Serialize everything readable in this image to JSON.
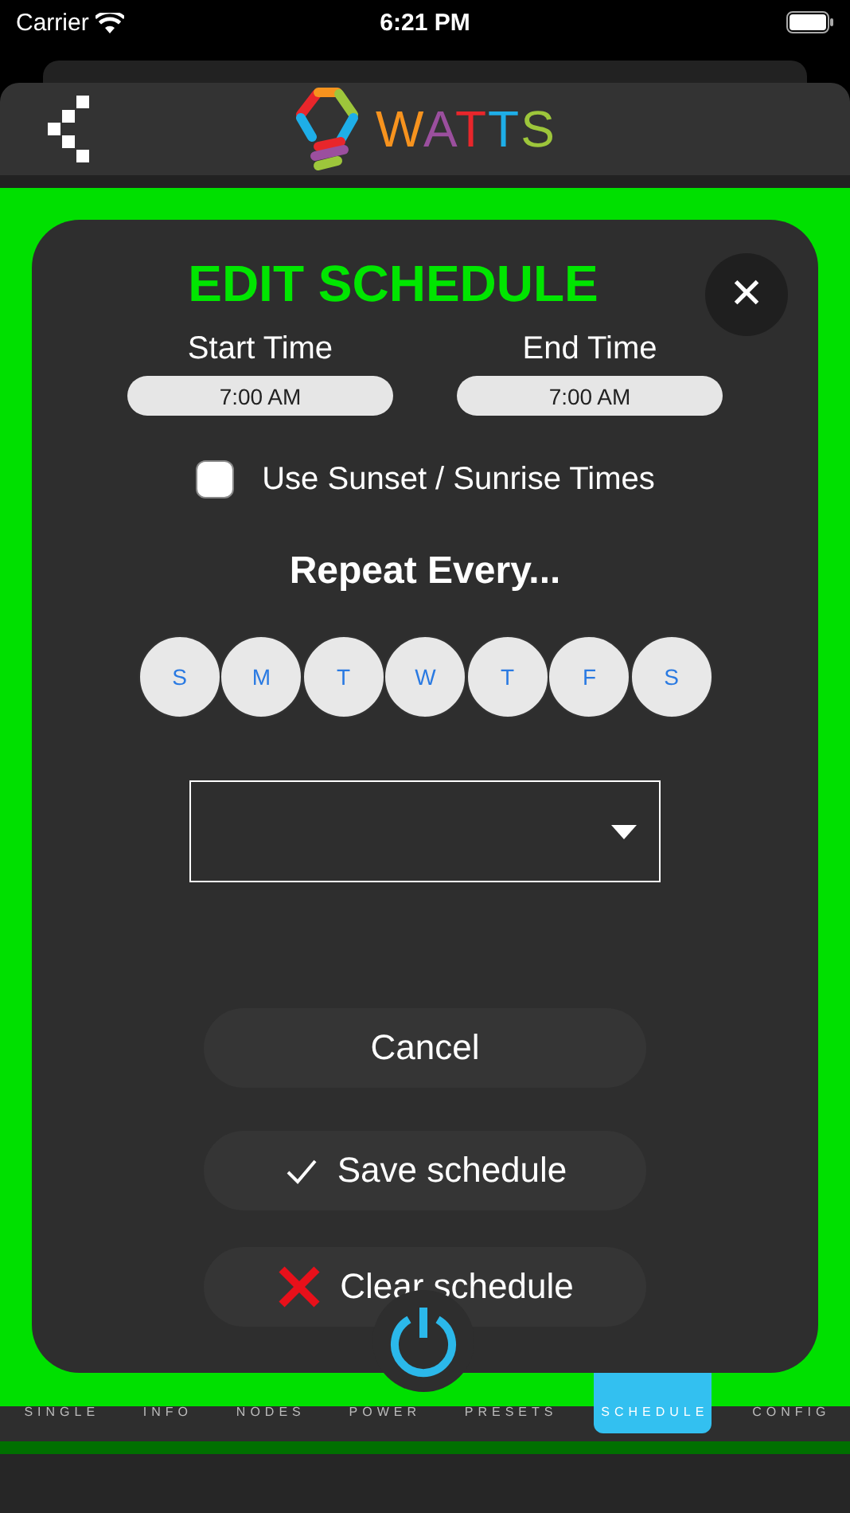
{
  "status_bar": {
    "carrier": "Carrier",
    "time": "6:21 PM"
  },
  "header": {
    "logo_text": "WATTS"
  },
  "dialog": {
    "title": "EDIT SCHEDULE",
    "close": "✕",
    "start": {
      "label": "Start Time",
      "value": "7:00 AM"
    },
    "end": {
      "label": "End Time",
      "value": "7:00 AM"
    },
    "sunset": {
      "label": "Use Sunset / Sunrise Times",
      "checked": false
    },
    "repeat_heading": "Repeat Every...",
    "days": [
      {
        "label": "S",
        "selected": false
      },
      {
        "label": "M",
        "selected": false
      },
      {
        "label": "T",
        "selected": false
      },
      {
        "label": "W",
        "selected": false
      },
      {
        "label": "T",
        "selected": false
      },
      {
        "label": "F",
        "selected": false
      },
      {
        "label": "S",
        "selected": false
      }
    ],
    "buttons": [
      {
        "kind": "plain",
        "label": "Cancel"
      },
      {
        "kind": "save",
        "label": "Save schedule"
      },
      {
        "kind": "clear",
        "label": "Clear schedule"
      }
    ]
  },
  "tabs": [
    {
      "label": "SINGLE",
      "selected": false
    },
    {
      "label": "INFO",
      "selected": false
    },
    {
      "label": "NODES",
      "selected": false
    },
    {
      "label": "POWER",
      "selected": false
    },
    {
      "label": "PRESETS",
      "selected": false
    },
    {
      "label": "SCHEDULE",
      "selected": true
    },
    {
      "label": "CONFIG",
      "selected": false
    }
  ]
}
